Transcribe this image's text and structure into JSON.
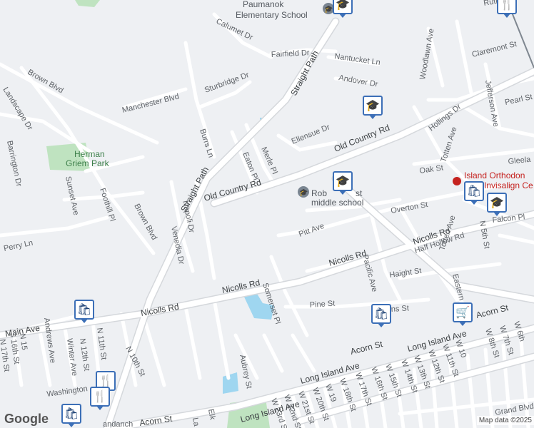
{
  "map": {
    "streets": {
      "old_country_rd": "Old Country Rd",
      "nicolls_rd": "Nicolls Rd",
      "straight_path": "Straight Path",
      "long_island_ave": "Long Island Ave",
      "acorn_st": "Acorn St",
      "main_ave": "Main Ave",
      "brown_blvd": "Brown Blvd",
      "manchester_blvd": "Manchester Blvd",
      "sturbridge_dr": "Sturbridge Dr",
      "calumet_dr": "Calumet Dr",
      "fairfield_dr": "Fairfield Dr",
      "nantucket_ln": "Nantucket Ln",
      "andover_dr": "Andover Dr",
      "ellensue_dr": "Ellensue Dr",
      "woodlawn_ave": "Woodlawn Ave",
      "claremont_st": "Claremont St",
      "jefferson_ave": "Jefferson Ave",
      "pearl_st": "Pearl St",
      "hollings_dr": "Hollings Dr",
      "totten_ave": "Totten Ave",
      "oak_st": "Oak St",
      "gleela": "Gleela",
      "overton_st": "Overton St",
      "falcon_pl": "Falcon Pl",
      "n_5th_st": "N 5th St",
      "pitt_ave": "Pitt Ave",
      "half_hollow_rd": "Half Hollow Rd",
      "haight_st": "Haight St",
      "pacific_ave": "Pacific Ave",
      "pine_st": "Pine St",
      "somerset_pl": "Somerset Pl",
      "merle_pl": "Merle Pl",
      "eaton_pl": "Eaton Pl",
      "burrs_ln": "Burrs Ln",
      "napoli_dr": "Napoli Dr",
      "venedia_dr": "Venedia Dr",
      "foothill_pl": "Foothill Pl",
      "perry_ln": "Perry Ln",
      "sunset_ave": "Sunset Ave",
      "landscape_dr": "Landscape Dr",
      "barrington_dr": "Barrington Dr",
      "andrews_ave": "Andrews Ave",
      "winter_ave": "Winter Ave",
      "n_11th_st": "N 11th St",
      "n_12th_st": "N 12th St",
      "n_10th_st": "N 10th St",
      "n_15": "N 15",
      "s_16th_st": "S 16th St",
      "n_17th_st": "N 17th St",
      "washington": "Washington",
      "aubrey_st": "Aubrey St",
      "w_23rd_st": "W 23rd St",
      "w_22nd_st": "W 22nd St",
      "w_21st_st": "W 21st St",
      "w_20th_st": "W 20th St",
      "w_19": "W 19",
      "w_18th_st": "W 18th St",
      "w_17th_st": "W 17th St",
      "w_16th_st": "W 16th St",
      "w_15th_st": "W 15th St",
      "w_14th_st": "W 14th St",
      "w_13th_st": "W 13th St",
      "w_12th_st": "W 12th St",
      "w_11th_st": "W 11th St",
      "w_10": "W 10",
      "w_8th_st": "W 8th St",
      "w_7th_st": "W 7th St",
      "w_6th": "W 6th",
      "grand_blvd": "Grand Blvd",
      "randanch": "andanch",
      "elk": "Elk",
      "la": "La",
      "rutla": "Rutla",
      "eastern": "Eastern",
      "ns_st": "ns St"
    },
    "pois": {
      "paumanok_line1": "Paumanok",
      "paumanok_line2": "Elementary School",
      "robert_frost_a": "Rob",
      "robert_frost_b": "st",
      "robert_frost_line2": "middle school",
      "island_ortho_line1": "Island Orthodon",
      "island_ortho_line2": "Invisalign Ce",
      "herman_park_line1": "Herman",
      "herman_park_line2": "Griem Park"
    },
    "attribution": "Map data ©2025",
    "logo": "Google",
    "colors": {
      "background": "#eef0f3",
      "road": "#ffffff",
      "major_road": "#ffffff",
      "road_casing": "#d5d8dc",
      "park": "#bfe3c0",
      "water": "#9fd6f0",
      "pin_border": "#3c6fb7",
      "poi_red": "#c5221f"
    },
    "icons": [
      "school-icon",
      "shopping-bag-icon",
      "restaurant-icon",
      "shopping-cart-icon"
    ]
  }
}
